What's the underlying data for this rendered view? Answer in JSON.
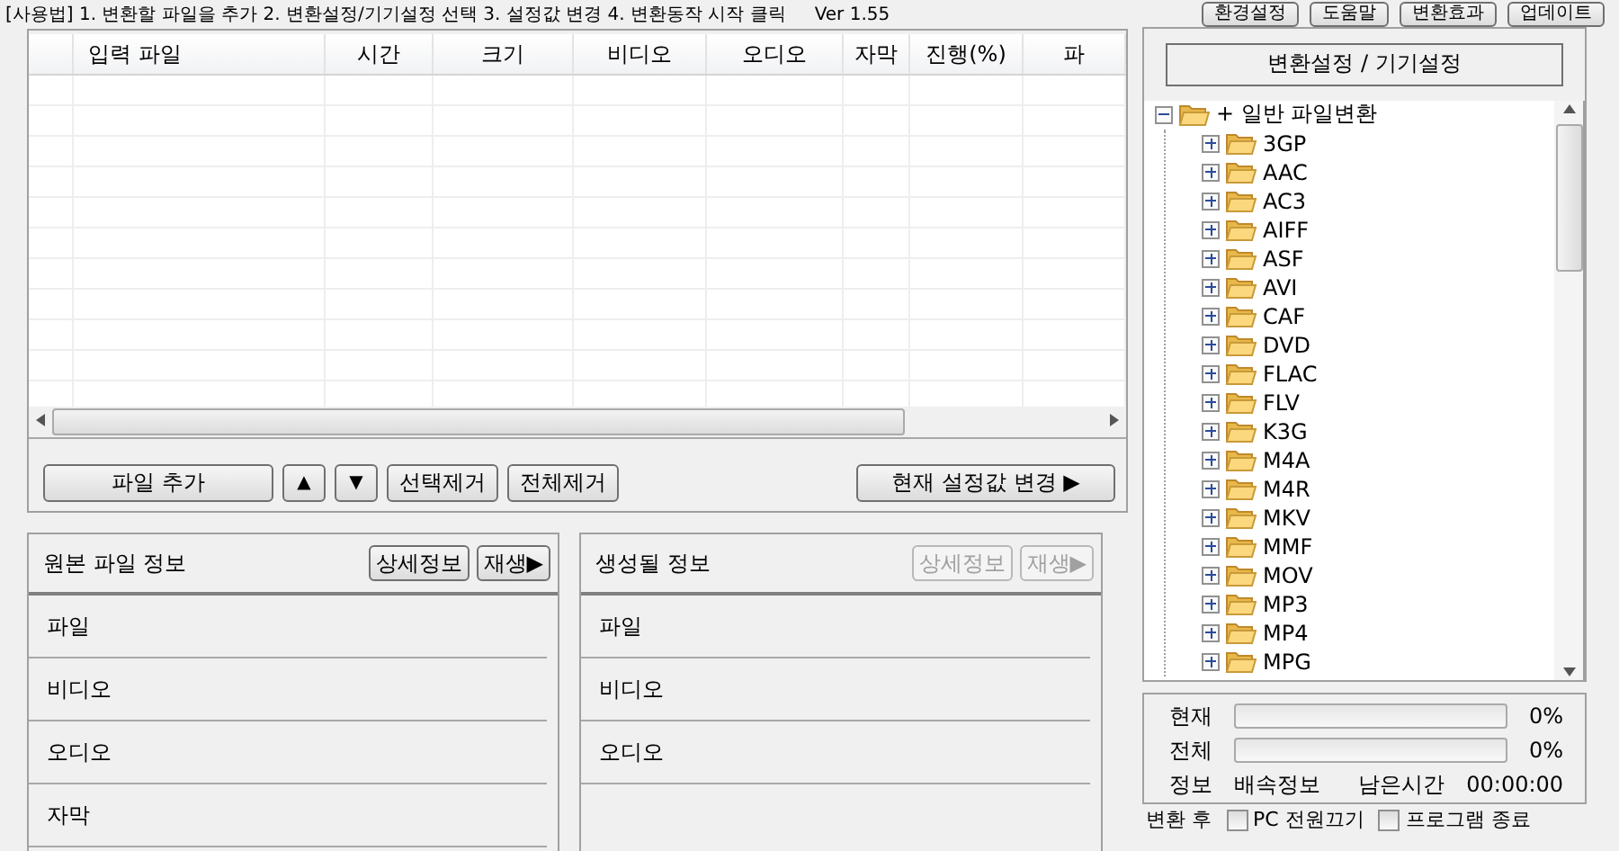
{
  "usage": {
    "text": "[사용법] 1. 변환할 파일을 추가   2. 변환설정/기기설정 선택   3. 설정값 변경   4. 변환동작 시작 클릭",
    "version": "Ver 1.55"
  },
  "top_buttons": [
    "환경설정",
    "도움말",
    "변환효과",
    "업데이트"
  ],
  "file_table": {
    "columns": [
      "입력 파일",
      "시간",
      "크기",
      "비디오",
      "오디오",
      "자막",
      "진행(%)",
      "파"
    ]
  },
  "file_buttons": [
    {
      "label": "파일 추가",
      "kind": "wide"
    },
    {
      "label": "▲",
      "kind": "arrow"
    },
    {
      "label": "▼",
      "kind": "arrow"
    },
    {
      "label": "선택제거",
      "kind": "normal"
    },
    {
      "label": "전체제거",
      "kind": "normal"
    },
    {
      "label": "현재 설정값 변경 ▶",
      "kind": "apply"
    }
  ],
  "source_info": {
    "title": "원본 파일 정보",
    "buttons": [
      {
        "label": "상세정보",
        "disabled": false
      },
      {
        "label": "재생▶",
        "disabled": false
      }
    ],
    "rows": [
      "파일",
      "비디오",
      "오디오",
      "자막"
    ]
  },
  "output_info": {
    "title": "생성될 정보",
    "buttons": [
      {
        "label": "상세정보",
        "disabled": true
      },
      {
        "label": "재생▶",
        "disabled": true
      }
    ],
    "rows": [
      "파일",
      "비디오",
      "오디오"
    ]
  },
  "settings_button": "변환설정 / 기기설정",
  "tree": {
    "items": [
      {
        "label": "+ 일반 파일변환",
        "expanded": true,
        "children": [
          {
            "label": "3GP",
            "expanded": false
          },
          {
            "label": "AAC",
            "expanded": false
          },
          {
            "label": "AC3",
            "expanded": false
          },
          {
            "label": "AIFF",
            "expanded": false
          },
          {
            "label": "ASF",
            "expanded": false
          },
          {
            "label": "AVI",
            "expanded": false
          },
          {
            "label": "CAF",
            "expanded": false
          },
          {
            "label": "DVD",
            "expanded": false
          },
          {
            "label": "FLAC",
            "expanded": false
          },
          {
            "label": "FLV",
            "expanded": false
          },
          {
            "label": "K3G",
            "expanded": false
          },
          {
            "label": "M4A",
            "expanded": false
          },
          {
            "label": "M4R",
            "expanded": false
          },
          {
            "label": "MKV",
            "expanded": false
          },
          {
            "label": "MMF",
            "expanded": false
          },
          {
            "label": "MOV",
            "expanded": false
          },
          {
            "label": "MP3",
            "expanded": false
          },
          {
            "label": "MP4",
            "expanded": false
          },
          {
            "label": "MPG",
            "expanded": false
          }
        ]
      }
    ]
  },
  "progress": {
    "bars": [
      {
        "label": "현재",
        "level": 0,
        "reading": "0%"
      },
      {
        "label": "전체",
        "level": 0,
        "reading": "0%"
      }
    ],
    "info": {
      "label": "정보",
      "speed": "배속정보",
      "remaining_label": "남은시간",
      "remaining": "00:00:00"
    }
  },
  "after": {
    "label": "변환 후",
    "options": [
      {
        "label": "PC 전원끄기",
        "checked": false
      },
      {
        "label": "프로그램 종료",
        "checked": false
      }
    ]
  }
}
